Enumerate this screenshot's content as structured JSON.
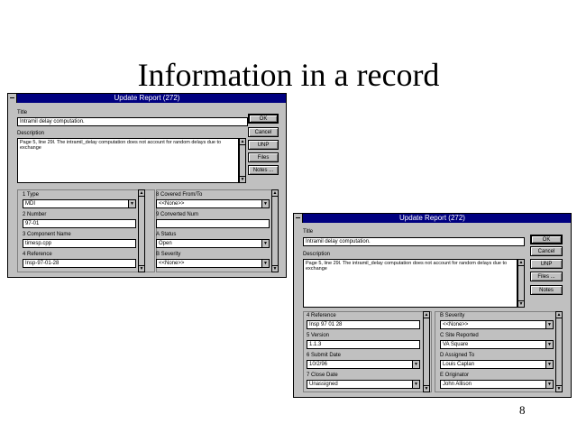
{
  "slide": {
    "title": "Information in a record",
    "page_number": "8"
  },
  "icons": {
    "up": "▲",
    "down": "▼",
    "dropdown": "▼"
  },
  "dialog1": {
    "title": "Update Report (272)",
    "title_label": "Title",
    "title_value": "Intramil delay computation.",
    "description_label": "Description",
    "description_value": "Page 5, line 29l.  The intramil_delay computation does not account for random delays due to exchange",
    "buttons": {
      "ok": "OK",
      "cancel": "Cancel",
      "unp": "UNP",
      "files": "Files",
      "notes": "Notes ..."
    },
    "left_fields": [
      {
        "label": "1 Type",
        "value": "MDI",
        "dropdown": true
      },
      {
        "label": "2 Number",
        "value": "97-01",
        "dropdown": false
      },
      {
        "label": "3 Component Name",
        "value": "timesp.cpp",
        "dropdown": false
      },
      {
        "label": "4 Reference",
        "value": "Insp-97-01-28",
        "dropdown": false
      }
    ],
    "right_fields": [
      {
        "label": "8 Covered From/To",
        "value": "<<None>>",
        "dropdown": true
      },
      {
        "label": "9 Converted Num",
        "value": "",
        "dropdown": false
      },
      {
        "label": "A Status",
        "value": "Open",
        "dropdown": true
      },
      {
        "label": "B Severity",
        "value": "<<None>>",
        "dropdown": true
      }
    ]
  },
  "dialog2": {
    "title": "Update Report (272)",
    "title_label": "Title",
    "title_value": "Intramil delay computation.",
    "description_label": "Description",
    "description_value": "Page 5, line 29l.  The intramil_delay computation does not account for random delays due to exchange",
    "buttons": {
      "ok": "OK",
      "cancel": "Cancel",
      "unp": "UNP",
      "files": "Files ...",
      "notes": "Notes"
    },
    "left_fields": [
      {
        "label": "4 Reference",
        "value": "Insp 97 01 28",
        "dropdown": false
      },
      {
        "label": "5 Version",
        "value": "1.1.3",
        "dropdown": false
      },
      {
        "label": "6 Submit Date",
        "value": "10/2/96",
        "dropdown": true
      },
      {
        "label": "7 Close Date",
        "value": "Unassigned",
        "dropdown": true
      }
    ],
    "right_fields": [
      {
        "label": "B Severity",
        "value": "<<None>>",
        "dropdown": true
      },
      {
        "label": "C Site Reported",
        "value": "VA Square",
        "dropdown": true
      },
      {
        "label": "D Assigned To",
        "value": "Louis Caplan",
        "dropdown": true
      },
      {
        "label": "E Originator",
        "value": "John Allison",
        "dropdown": true
      }
    ]
  }
}
